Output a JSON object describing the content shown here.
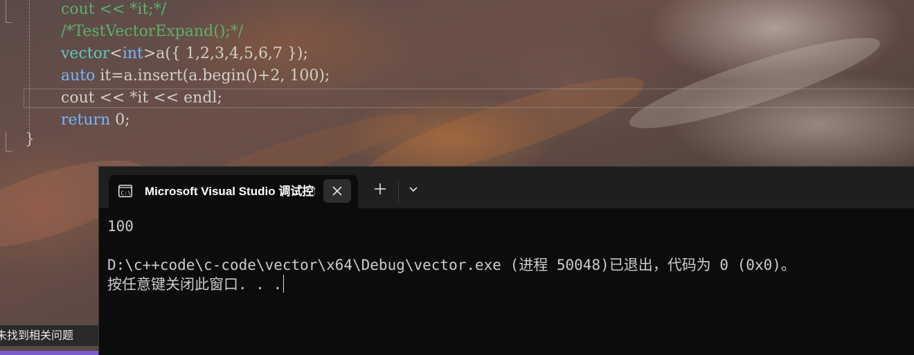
{
  "editor": {
    "code_lines": [
      {
        "parts": [
          {
            "t": "cout << *it;*/",
            "c": "cm"
          }
        ]
      },
      {
        "parts": [
          {
            "t": "/*TestVectorExpand();*/",
            "c": "cm"
          }
        ]
      },
      {
        "parts": [
          {
            "t": "vector",
            "c": "ty"
          },
          {
            "t": "<",
            "c": "op"
          },
          {
            "t": "int",
            "c": "kw"
          },
          {
            "t": ">",
            "c": "op"
          },
          {
            "t": "a({ 1,2,3,4,5,6,7 });",
            "c": "op"
          }
        ]
      },
      {
        "parts": [
          {
            "t": "auto",
            "c": "kw"
          },
          {
            "t": " it=a.insert(a.begin()+2, 100);",
            "c": "op"
          }
        ]
      },
      {
        "parts": [
          {
            "t": "cout << *it << endl;",
            "c": "op"
          }
        ]
      },
      {
        "parts": [
          {
            "t": "return",
            "c": "kw"
          },
          {
            "t": " 0;",
            "c": "op"
          }
        ]
      }
    ],
    "closing_brace": "}",
    "problems_status": "未找到相关问题"
  },
  "terminal": {
    "tab_title": "Microsoft Visual Studio 调试控制台",
    "tab_icon": "terminal-icon",
    "close_icon": "close-icon",
    "new_tab_icon": "plus-icon",
    "dropdown_icon": "chevron-down-icon",
    "output_line1": "100",
    "output_line2": "D:\\c++code\\c-code\\vector\\x64\\Debug\\vector.exe (进程 50048)已退出，代码为 0 (0x0)。",
    "output_line3": "按任意键关闭此窗口. . ."
  },
  "colors": {
    "terminal_bg": "#0c0c0c",
    "tabbar_bg": "#1f1f1f",
    "keyword": "#78b5ff",
    "type": "#5fc7c0",
    "comment": "#5fb06b"
  }
}
